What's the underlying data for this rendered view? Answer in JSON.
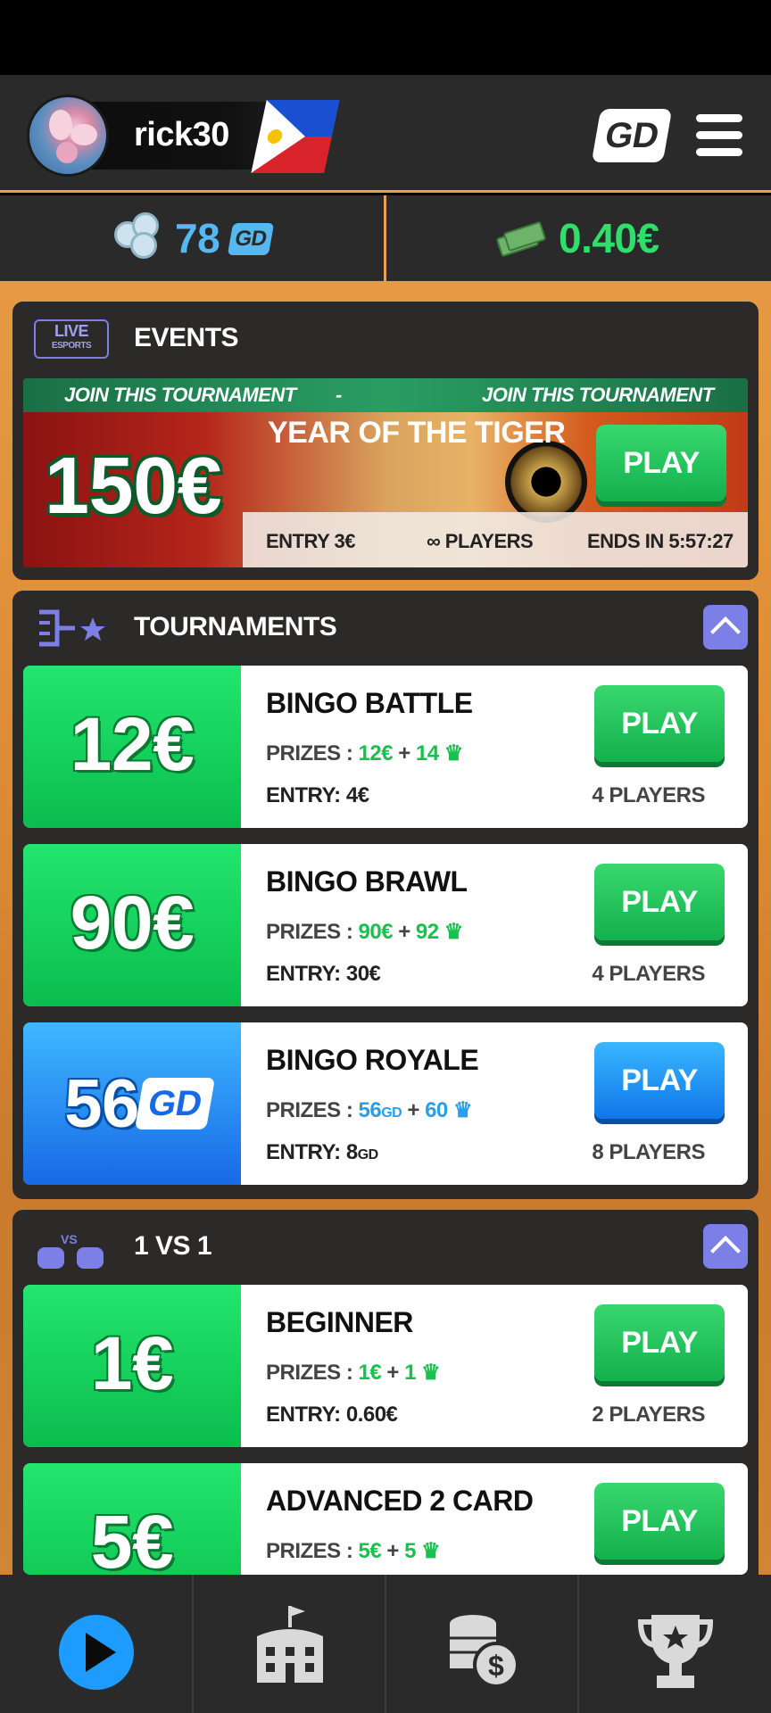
{
  "header": {
    "username": "rick30",
    "logo_text": "GD"
  },
  "balances": {
    "coins_value": "78",
    "coins_unit": "GD",
    "cash_value": "0.40€"
  },
  "events": {
    "title": "EVENTS",
    "badge_line1": "LIVE",
    "badge_line2": "ESPORTS",
    "strip_left": "JOIN THIS TOURNAMENT",
    "strip_sep": "-",
    "strip_right": "JOIN THIS TOURNAMENT",
    "event_name": "YEAR OF THE TIGER",
    "prize": "150€",
    "play_label": "PLAY",
    "entry": "ENTRY 3€",
    "players": "∞ PLAYERS",
    "ends": "ENDS IN 5:57:27"
  },
  "tournaments": {
    "title": "TOURNAMENTS",
    "items": [
      {
        "prize": "12€",
        "name": "BINGO BATTLE",
        "prize_main": "12€",
        "prize_trophy": "14",
        "entry_label": "ENTRY:",
        "entry": "4€",
        "players": "4 PLAYERS",
        "play_label": "PLAY"
      },
      {
        "prize": "90€",
        "name": "BINGO BRAWL",
        "prize_main": "90€",
        "prize_trophy": "92",
        "entry_label": "ENTRY:",
        "entry": "30€",
        "players": "4 PLAYERS",
        "play_label": "PLAY"
      },
      {
        "prize": "56",
        "prize_unit": "GD",
        "name": "BINGO ROYALE",
        "prize_main": "56",
        "prize_trophy": "60",
        "entry_label": "ENTRY:",
        "entry": "8",
        "players": "8 PLAYERS",
        "play_label": "PLAY"
      }
    ]
  },
  "onevone": {
    "title": "1 VS 1",
    "items": [
      {
        "prize": "1€",
        "name": "BEGINNER",
        "prize_main": "1€",
        "prize_trophy": "1",
        "entry_label": "ENTRY:",
        "entry": "0.60€",
        "players": "2 PLAYERS",
        "play_label": "PLAY"
      },
      {
        "prize": "5€",
        "name": "ADVANCED 2 CARD",
        "prize_main": "5€",
        "prize_trophy": "5",
        "play_label": "PLAY"
      }
    ]
  },
  "labels": {
    "prizes": "PRIZES :",
    "plus": "+",
    "gd": "GD"
  },
  "colors": {
    "accent_orange": "#e7a14f",
    "green": "#16c24d",
    "blue": "#2a9ee8",
    "collapse_purple": "#7b7fe6"
  },
  "nav": {
    "icons": [
      "play-icon",
      "stadium-icon",
      "coins-dollar-icon",
      "trophy-icon"
    ]
  }
}
